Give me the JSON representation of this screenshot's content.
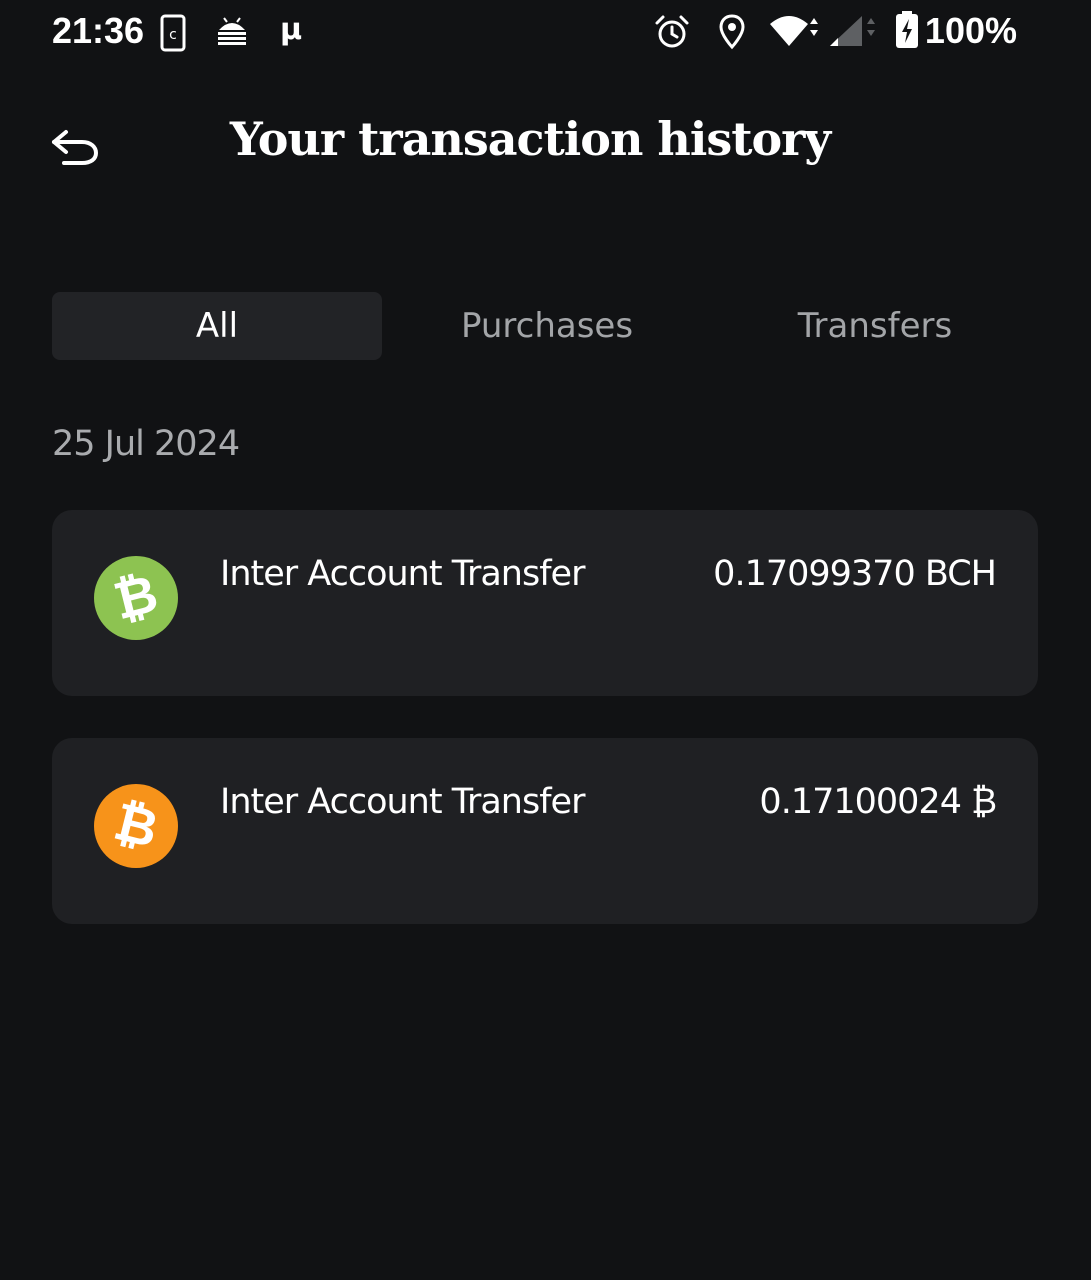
{
  "status_bar": {
    "time": "21:36",
    "battery_percent": "100%",
    "icons": [
      "screenshot-icon",
      "android-debug-icon",
      "micro-icon",
      "alarm-icon",
      "location-icon",
      "wifi-icon",
      "cellular-signal-icon",
      "battery-charging-icon"
    ]
  },
  "header": {
    "back_icon": "back-arrow-icon",
    "title": "Your transaction history"
  },
  "tabs": [
    {
      "label": "All",
      "active": true
    },
    {
      "label": "Purchases",
      "active": false
    },
    {
      "label": "Transfers",
      "active": false
    }
  ],
  "groups": [
    {
      "date": "25 Jul 2024",
      "transactions": [
        {
          "label": "Inter Account Transfer",
          "amount": "0.17099370 BCH",
          "coin_icon": "bitcoin-cash-icon",
          "icon_color": "#8dc351",
          "icon_glyph": "₿"
        },
        {
          "label": "Inter Account Transfer",
          "amount": "0.17100024 ₿",
          "coin_icon": "bitcoin-icon",
          "icon_color": "#f7931a",
          "icon_glyph": "₿"
        }
      ]
    }
  ],
  "colors": {
    "background": "#111214",
    "card": "#1f2023",
    "tab_active": "#222326",
    "muted_text": "#a3a5a8"
  }
}
